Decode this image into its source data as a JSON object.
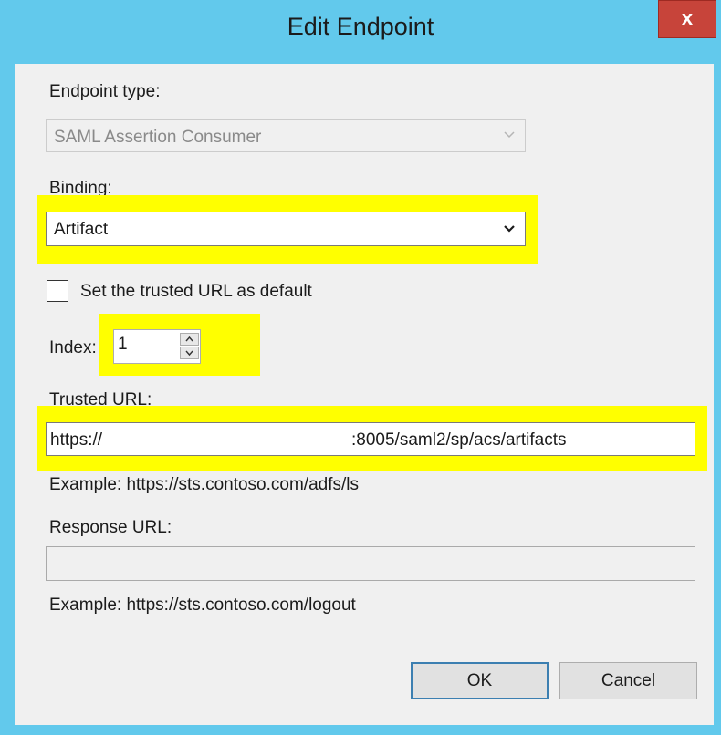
{
  "window": {
    "title": "Edit Endpoint",
    "close_label": "x"
  },
  "endpoint_type": {
    "label": "Endpoint type:",
    "value": "SAML Assertion Consumer"
  },
  "binding": {
    "label": "Binding:",
    "value": "Artifact"
  },
  "default_checkbox": {
    "label": "Set the trusted URL as default",
    "checked": false
  },
  "index": {
    "label": "Index:",
    "value": "1"
  },
  "trusted_url": {
    "label": "Trusted URL:",
    "value_prefix": "https://",
    "value_suffix": ":8005/saml2/sp/acs/artifacts",
    "example": "Example: https://sts.contoso.com/adfs/ls"
  },
  "response_url": {
    "label": "Response URL:",
    "value": "",
    "example": "Example: https://sts.contoso.com/logout"
  },
  "buttons": {
    "ok": "OK",
    "cancel": "Cancel"
  },
  "colors": {
    "titlebar": "#62c9ec",
    "close_button": "#c7443a",
    "highlight": "#ffff00",
    "dialog_background": "#f0f0f0"
  }
}
